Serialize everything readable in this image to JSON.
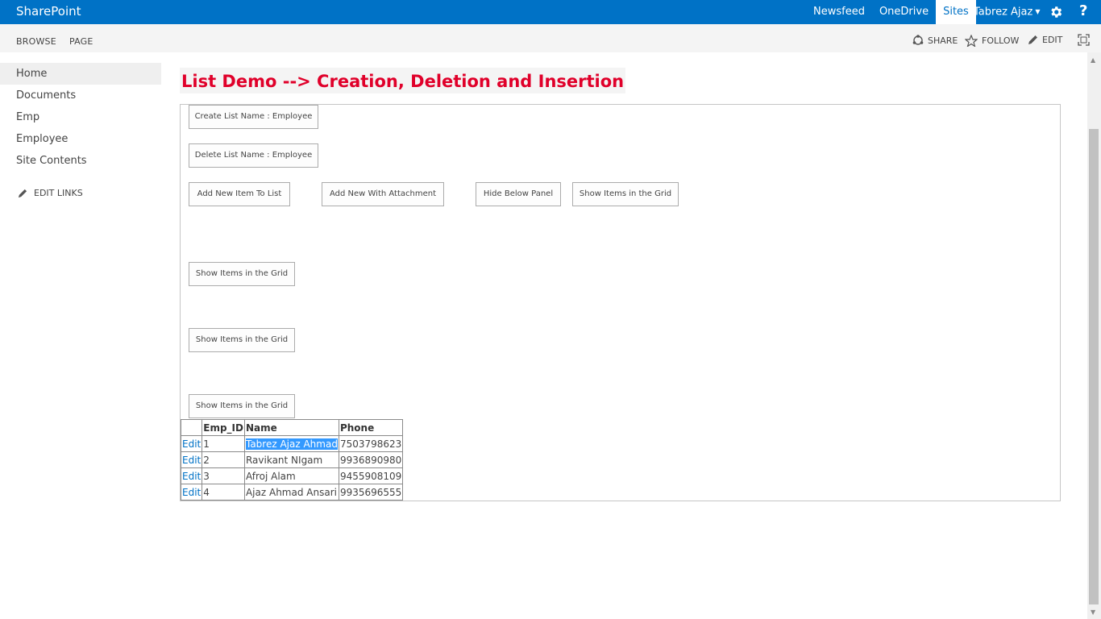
{
  "suitebar": {
    "brand": "SharePoint",
    "links": [
      "Newsfeed",
      "OneDrive",
      "Sites"
    ],
    "active_link": "Sites",
    "user": "Tabrez Ajaz",
    "help": "?"
  },
  "ribbon": {
    "tabs": [
      "BROWSE",
      "PAGE"
    ],
    "actions": {
      "share": "SHARE",
      "follow": "FOLLOW",
      "edit": "EDIT"
    }
  },
  "leftnav": {
    "items": [
      "Home",
      "Documents",
      "Emp",
      "Employee",
      "Site Contents"
    ],
    "selected": "Home",
    "edit_links": "EDIT LINKS"
  },
  "main": {
    "title": "List Demo --> Creation, Deletion and Insertion",
    "buttons": {
      "create_list": "Create List Name : Employee",
      "delete_list": "Delete List Name : Employee",
      "add_item": "Add New Item To List",
      "add_attachment": "Add New With Attachment",
      "hide_panel": "Hide Below Panel",
      "show_grid": "Show Items in the Grid"
    },
    "grid": {
      "columns": [
        "",
        "Emp_ID",
        "Name",
        "Phone"
      ],
      "rows": [
        {
          "action": "Edit",
          "emp_id": "1",
          "name": "Tabrez Ajaz Ahmad",
          "phone": "7503798623"
        },
        {
          "action": "Edit",
          "emp_id": "2",
          "name": "Ravikant NIgam",
          "phone": "9936890980"
        },
        {
          "action": "Edit",
          "emp_id": "3",
          "name": "Afroj Alam",
          "phone": "9455908109"
        },
        {
          "action": "Edit",
          "emp_id": "4",
          "name": "Ajaz Ahmad Ansari",
          "phone": "9935696555"
        }
      ]
    }
  },
  "colors": {
    "suitebar": "#0072c6",
    "title": "#e0002a",
    "link": "#0072c6",
    "selection": "#3399ff"
  }
}
